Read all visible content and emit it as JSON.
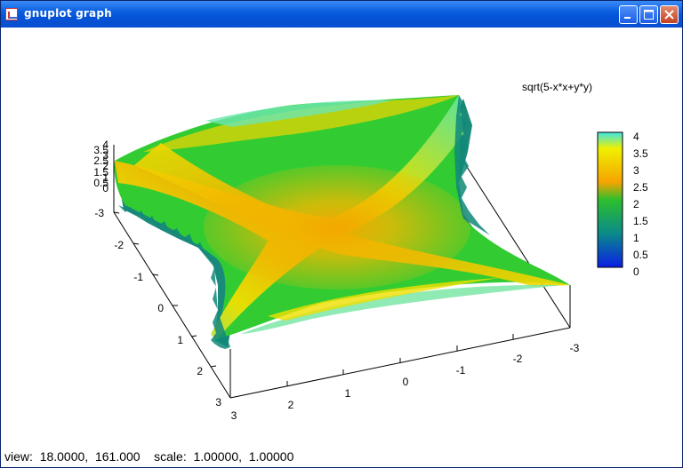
{
  "window": {
    "title": "gnuplot graph",
    "icon": "gnuplot-app-icon",
    "controls": {
      "minimize": "minimize-icon",
      "maximize": "maximize-icon",
      "close": "close-icon"
    }
  },
  "plot": {
    "function_label": "sqrt(5-x*x+y*y)",
    "colorbar": {
      "ticks": [
        "4",
        "3.5",
        "3",
        "2.5",
        "2",
        "1.5",
        "1",
        "0.5",
        "0"
      ],
      "palette": [
        "#3de6e6",
        "#f0f000",
        "#f5a300",
        "#2dbf2d",
        "#0a8a8a",
        "#0a1ee6"
      ]
    },
    "z_ticks": [
      "4",
      "3.5",
      "3",
      "2.5",
      "2",
      "1.5",
      "1",
      "0.5",
      "0"
    ],
    "x_axis_front_ticks": [
      "3",
      "2",
      "1",
      "0",
      "-1",
      "-2",
      "-3"
    ],
    "y_axis_left_ticks": [
      "-3",
      "-2",
      "-1",
      "0",
      "1",
      "2",
      "3"
    ]
  },
  "status": {
    "view_label": "view:",
    "view_values": "18.0000,  161.000",
    "scale_label": "scale:",
    "scale_values": "1.00000,  1.00000"
  }
}
